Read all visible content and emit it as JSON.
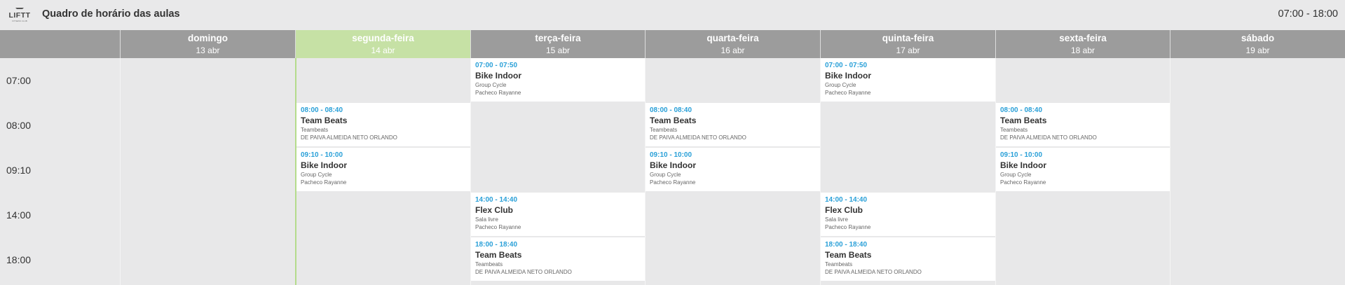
{
  "app": {
    "logo_text": "LIFTT",
    "logo_sub": "FITNESS CLUB",
    "title": "Quadro de horário das aulas",
    "time_range": "07:00 - 18:00"
  },
  "days": [
    {
      "name": "domingo",
      "date": "13 abr",
      "active": false
    },
    {
      "name": "segunda-feira",
      "date": "14 abr",
      "active": true
    },
    {
      "name": "terça-feira",
      "date": "15 abr",
      "active": false
    },
    {
      "name": "quarta-feira",
      "date": "16 abr",
      "active": false
    },
    {
      "name": "quinta-feira",
      "date": "17 abr",
      "active": false
    },
    {
      "name": "sexta-feira",
      "date": "18 abr",
      "active": false
    },
    {
      "name": "sábado",
      "date": "19 abr",
      "active": false
    }
  ],
  "time_slots": [
    "07:00",
    "08:00",
    "09:10",
    "14:00",
    "18:00"
  ],
  "events": [
    {
      "day": 2,
      "slot": 0,
      "time": "07:00 - 07:50",
      "title": "Bike Indoor",
      "category": "Group Cycle",
      "instructor": "Pacheco Rayanne"
    },
    {
      "day": 4,
      "slot": 0,
      "time": "07:00 - 07:50",
      "title": "Bike Indoor",
      "category": "Group Cycle",
      "instructor": "Pacheco Rayanne"
    },
    {
      "day": 1,
      "slot": 1,
      "time": "08:00 - 08:40",
      "title": "Team Beats",
      "category": "Teambeats",
      "instructor": "DE PAIVA ALMEIDA NETO ORLANDO"
    },
    {
      "day": 3,
      "slot": 1,
      "time": "08:00 - 08:40",
      "title": "Team Beats",
      "category": "Teambeats",
      "instructor": "DE PAIVA ALMEIDA NETO ORLANDO"
    },
    {
      "day": 5,
      "slot": 1,
      "time": "08:00 - 08:40",
      "title": "Team Beats",
      "category": "Teambeats",
      "instructor": "DE PAIVA ALMEIDA NETO ORLANDO"
    },
    {
      "day": 1,
      "slot": 2,
      "time": "09:10 - 10:00",
      "title": "Bike Indoor",
      "category": "Group Cycle",
      "instructor": "Pacheco Rayanne"
    },
    {
      "day": 3,
      "slot": 2,
      "time": "09:10 - 10:00",
      "title": "Bike Indoor",
      "category": "Group Cycle",
      "instructor": "Pacheco Rayanne"
    },
    {
      "day": 5,
      "slot": 2,
      "time": "09:10 - 10:00",
      "title": "Bike Indoor",
      "category": "Group Cycle",
      "instructor": "Pacheco Rayanne"
    },
    {
      "day": 2,
      "slot": 3,
      "time": "14:00 - 14:40",
      "title": "Flex Club",
      "category": "Sala livre",
      "instructor": "Pacheco Rayanne"
    },
    {
      "day": 4,
      "slot": 3,
      "time": "14:00 - 14:40",
      "title": "Flex Club",
      "category": "Sala livre",
      "instructor": "Pacheco Rayanne"
    },
    {
      "day": 2,
      "slot": 4,
      "time": "18:00 - 18:40",
      "title": "Team Beats",
      "category": "Teambeats",
      "instructor": "DE PAIVA ALMEIDA NETO ORLANDO"
    },
    {
      "day": 4,
      "slot": 4,
      "time": "18:00 - 18:40",
      "title": "Team Beats",
      "category": "Teambeats",
      "instructor": "DE PAIVA ALMEIDA NETO ORLANDO"
    }
  ]
}
